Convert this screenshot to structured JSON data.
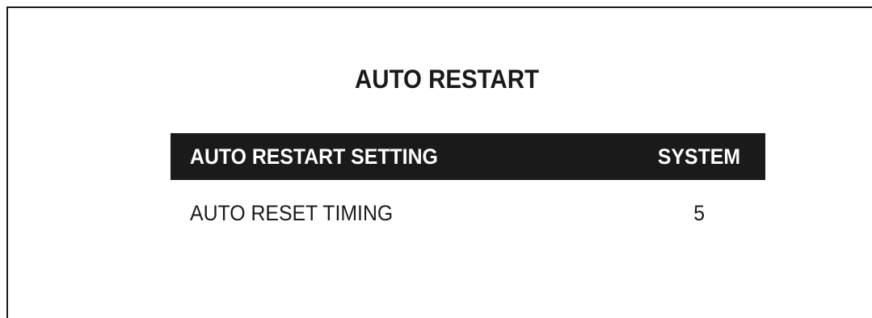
{
  "screen": {
    "title": "AUTO RESTART"
  },
  "menu": {
    "items": [
      {
        "label": "AUTO RESTART SETTING",
        "value": "SYSTEM",
        "selected": true
      },
      {
        "label": "AUTO RESET TIMING",
        "value": "5",
        "selected": false
      }
    ]
  },
  "colors": {
    "background": "#ffffff",
    "text": "#1a1a1a",
    "highlight_bg": "#1a1a1a",
    "highlight_text": "#ffffff"
  }
}
